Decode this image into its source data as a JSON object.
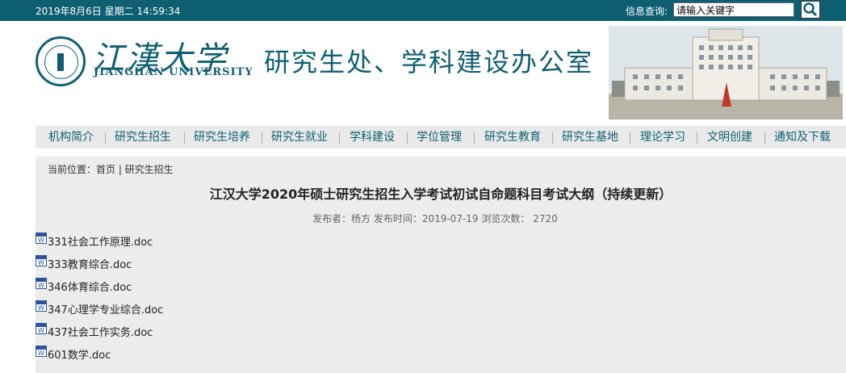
{
  "topbar": {
    "datetime": "2019年8月6日 星期二 14:59:34",
    "search_label": "信息查询:",
    "search_value": "请输入关键字"
  },
  "header": {
    "logo_cn": "江漢大学",
    "logo_en": "JIANGHAN UNIVERSITY",
    "office_title": "研究生处、学科建设办公室"
  },
  "nav": {
    "items": [
      {
        "label": "机构简介"
      },
      {
        "label": "研究生招生"
      },
      {
        "label": "研究生培养"
      },
      {
        "label": "研究生就业"
      },
      {
        "label": "学科建设"
      },
      {
        "label": "学位管理"
      },
      {
        "label": "研究生教育"
      },
      {
        "label": "研究生基地"
      },
      {
        "label": "理论学习"
      },
      {
        "label": "文明创建"
      },
      {
        "label": "通知及下载"
      }
    ]
  },
  "breadcrumb": {
    "text": "当前位置：首页 | 研究生招生"
  },
  "article": {
    "title": "江汉大学2020年硕士研究生招生入学考试初试自命题科目考试大纲（持续更新）",
    "meta": "发布者：杨方   发布时间：2019-07-19   浏览次数：  2720",
    "files": [
      {
        "name": "331社会工作原理.doc"
      },
      {
        "name": "333教育综合.doc"
      },
      {
        "name": "346体育综合.doc"
      },
      {
        "name": "347心理学专业综合.doc"
      },
      {
        "name": "437社会工作实务.doc"
      },
      {
        "name": "601数学.doc"
      }
    ]
  },
  "colors": {
    "primary": "#0f5f73",
    "nav_bg": "#e9e9e9",
    "content_bg": "#ececec"
  }
}
